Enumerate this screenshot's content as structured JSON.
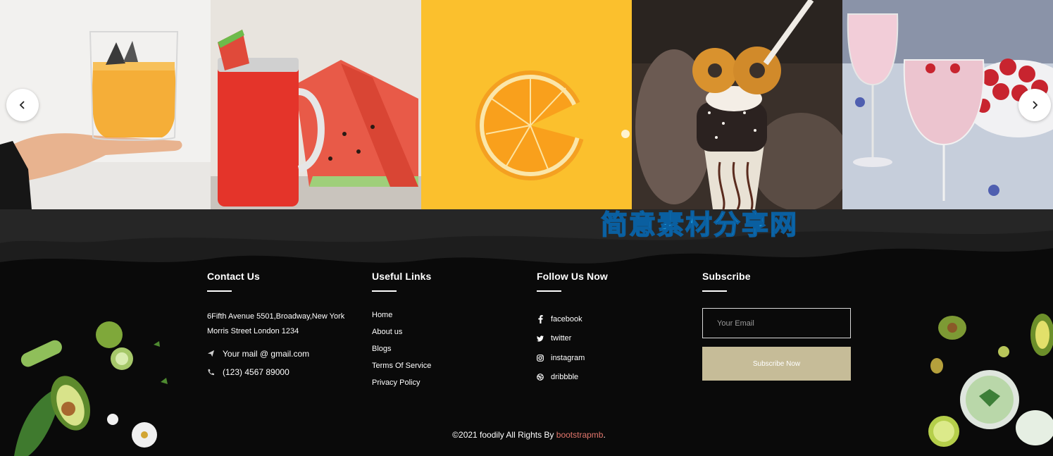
{
  "gallery": {
    "images": [
      {
        "name": "orange-cocktail-glass"
      },
      {
        "name": "watermelon-juice-jar"
      },
      {
        "name": "orange-slice"
      },
      {
        "name": "donut-milkshake"
      },
      {
        "name": "raspberry-smoothie"
      }
    ],
    "prev_icon": "chevron-left-icon",
    "next_icon": "chevron-right-icon"
  },
  "watermark": "简意素材分享网",
  "footer": {
    "contact": {
      "title": "Contact Us",
      "address_line1": "6Fifth Avenue 5501,Broadway,New York",
      "address_line2": "Morris Street London 1234",
      "email": "Your mail @ gmail.com",
      "phone": "(123) 4567 89000",
      "email_icon": "paper-plane-icon",
      "phone_icon": "phone-icon"
    },
    "links": {
      "title": "Useful Links",
      "items": [
        "Home",
        "About us",
        "Blogs",
        "Terms Of Service",
        "Privacy Policy"
      ]
    },
    "follow": {
      "title": "Follow Us Now",
      "items": [
        {
          "label": "facebook",
          "icon": "facebook-icon"
        },
        {
          "label": "twitter",
          "icon": "twitter-icon"
        },
        {
          "label": "instagram",
          "icon": "instagram-icon"
        },
        {
          "label": "dribbble",
          "icon": "dribbble-icon"
        }
      ]
    },
    "subscribe": {
      "title": "Subscribe",
      "placeholder": "Your Email",
      "button_label": "Subscribe Now"
    },
    "copyright": {
      "prefix": "©2021 foodily All Rights By ",
      "brand": "bootstrapmb",
      "suffix": "."
    }
  },
  "colors": {
    "background": "#0b0b0b",
    "accent_button": "#c6bc98",
    "brand_link": "#e2766c",
    "watermark": "#1aa0e6"
  }
}
